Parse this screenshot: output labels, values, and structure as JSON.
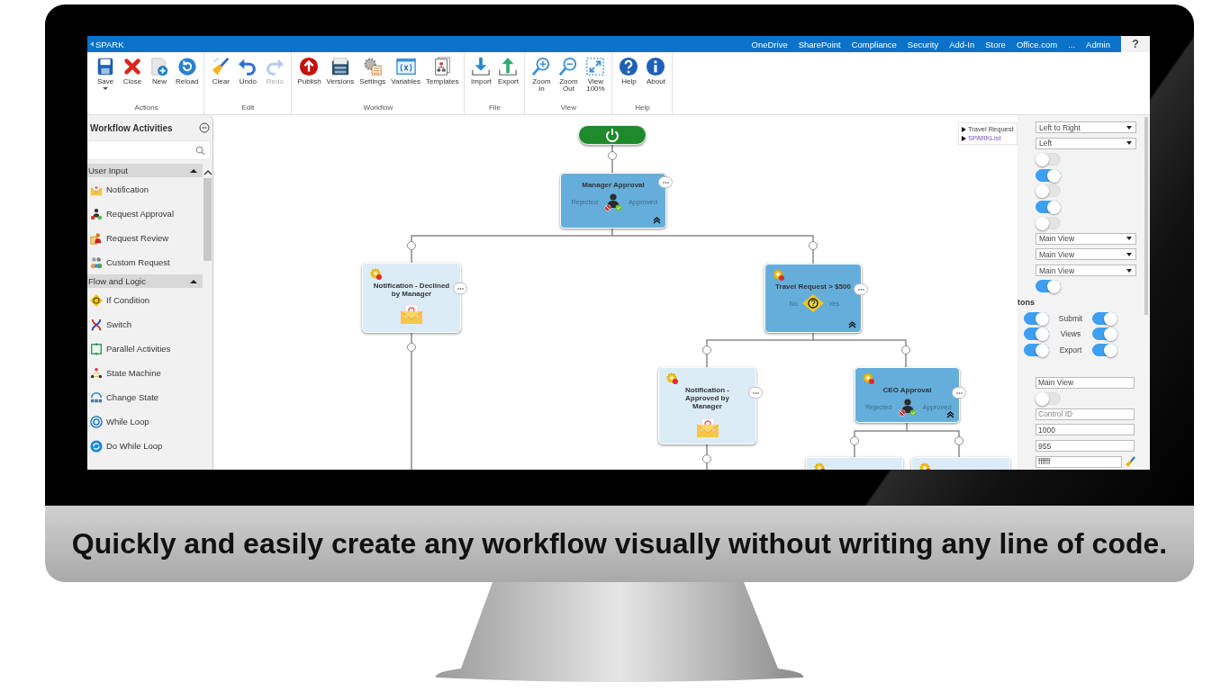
{
  "monitor": {
    "caption": "Quickly and easily create any workflow visually without writing any line of code."
  },
  "app": {
    "title": "SPARK",
    "top_nav": [
      "OneDrive",
      "SharePoint",
      "Compliance",
      "Security",
      "Add-In",
      "Store",
      "Office.com",
      "...",
      "Admin"
    ],
    "help_label": "?"
  },
  "ribbon": {
    "groups": [
      {
        "label": "Actions",
        "buttons": [
          {
            "kind": "save",
            "label": "Save",
            "has_menu": true,
            "disabled": false
          },
          {
            "kind": "close",
            "label": "Close",
            "has_menu": false,
            "disabled": false
          },
          {
            "kind": "new",
            "label": "New",
            "has_menu": false,
            "disabled": false
          },
          {
            "kind": "reload",
            "label": "Reload",
            "has_menu": false,
            "disabled": false
          }
        ]
      },
      {
        "label": "Edit",
        "buttons": [
          {
            "kind": "clear",
            "label": "Clear",
            "has_menu": false,
            "disabled": false
          },
          {
            "kind": "undo",
            "label": "Undo",
            "has_menu": false,
            "disabled": false
          },
          {
            "kind": "redo",
            "label": "Redo",
            "has_menu": false,
            "disabled": true
          }
        ]
      },
      {
        "label": "Workflow",
        "buttons": [
          {
            "kind": "publish",
            "label": "Publish",
            "has_menu": false,
            "disabled": false
          },
          {
            "kind": "versions",
            "label": "Versions",
            "has_menu": false,
            "disabled": false
          },
          {
            "kind": "settings",
            "label": "Settings",
            "has_menu": false,
            "disabled": false
          },
          {
            "kind": "variables",
            "label": "Variables",
            "has_menu": false,
            "disabled": false
          },
          {
            "kind": "templates",
            "label": "Templates",
            "has_menu": false,
            "disabled": false
          }
        ]
      },
      {
        "label": "File",
        "buttons": [
          {
            "kind": "import",
            "label": "Import",
            "has_menu": false,
            "disabled": false
          },
          {
            "kind": "export",
            "label": "Export",
            "has_menu": false,
            "disabled": false
          }
        ]
      },
      {
        "label": "View",
        "buttons": [
          {
            "kind": "zoomin",
            "label": "Zoom In",
            "has_menu": false,
            "disabled": false
          },
          {
            "kind": "zoomout",
            "label": "Zoom Out",
            "has_menu": false,
            "disabled": false
          },
          {
            "kind": "view100",
            "label": "View 100%",
            "has_menu": false,
            "disabled": false
          }
        ]
      },
      {
        "label": "Help",
        "buttons": [
          {
            "kind": "help",
            "label": "Help",
            "has_menu": false,
            "disabled": false
          },
          {
            "kind": "about",
            "label": "About",
            "has_menu": false,
            "disabled": false
          }
        ]
      }
    ]
  },
  "sidebar": {
    "title": "Workflow Activities",
    "groups": [
      {
        "label": "User Input",
        "expanded": true,
        "items": [
          {
            "kind": "notification",
            "label": "Notification"
          },
          {
            "kind": "approval",
            "label": "Request Approval"
          },
          {
            "kind": "review",
            "label": "Request Review"
          },
          {
            "kind": "custom",
            "label": "Custom Request"
          }
        ]
      },
      {
        "label": "Flow and Logic",
        "expanded": true,
        "items": [
          {
            "kind": "condition",
            "label": "If Condition"
          },
          {
            "kind": "switch",
            "label": "Switch"
          },
          {
            "kind": "parallel",
            "label": "Parallel Activities"
          },
          {
            "kind": "state",
            "label": "State Machine"
          },
          {
            "kind": "change_state",
            "label": "Change State"
          },
          {
            "kind": "while",
            "label": "While Loop"
          },
          {
            "kind": "dowhile",
            "label": "Do While Loop"
          }
        ]
      }
    ]
  },
  "canvas": {
    "nodes": [
      {
        "kind": "approval",
        "title": "Manager Approval",
        "left_label": "Rejected",
        "right_label": "Approved",
        "warning": false
      },
      {
        "kind": "notification",
        "title": "Notification - Declined by Manager",
        "warning": true
      },
      {
        "kind": "condition",
        "title": "Travel Request > $500",
        "left_label": "No",
        "right_label": "Yes",
        "warning": true
      },
      {
        "kind": "notification",
        "title": "Notification - Approved by Manager",
        "warning": true
      },
      {
        "kind": "approval",
        "title": "CEO Approval",
        "left_label": "Rejected",
        "right_label": "Approved",
        "warning": true
      },
      {
        "kind": "notification",
        "warning": true
      },
      {
        "kind": "notification",
        "warning": true
      }
    ],
    "breadcrumb": [
      {
        "kind": "text",
        "label": "Travel Request"
      },
      {
        "kind": "link",
        "label": "SPARKList"
      }
    ]
  },
  "properties": {
    "items": [
      {
        "kind": "dropdown",
        "value": "Left to Right"
      },
      {
        "kind": "dropdown",
        "value": "Left"
      },
      {
        "kind": "toggle",
        "on": false
      },
      {
        "kind": "toggle",
        "on": true
      },
      {
        "kind": "toggle",
        "on": false
      },
      {
        "kind": "toggle",
        "on": true
      },
      {
        "kind": "toggle",
        "on": false
      },
      {
        "kind": "dropdown",
        "value": "Main View"
      },
      {
        "kind": "dropdown",
        "value": "Main View"
      },
      {
        "kind": "dropdown",
        "value": "Main View"
      },
      {
        "kind": "toggle",
        "on": true
      }
    ],
    "section_label": "tons",
    "button_rows": [
      {
        "label": "Submit",
        "left_on": true,
        "right_on": true
      },
      {
        "label": "Views",
        "left_on": true,
        "right_on": true
      },
      {
        "label": "Export",
        "left_on": true,
        "right_on": true
      }
    ],
    "fields": [
      {
        "kind": "text",
        "value": "Main View"
      },
      {
        "kind": "toggle",
        "on": false
      },
      {
        "kind": "text",
        "placeholder": "Control ID"
      },
      {
        "kind": "text",
        "value": "1000"
      },
      {
        "kind": "text",
        "value": "955"
      },
      {
        "kind": "color",
        "value": "ffffff"
      }
    ]
  }
}
